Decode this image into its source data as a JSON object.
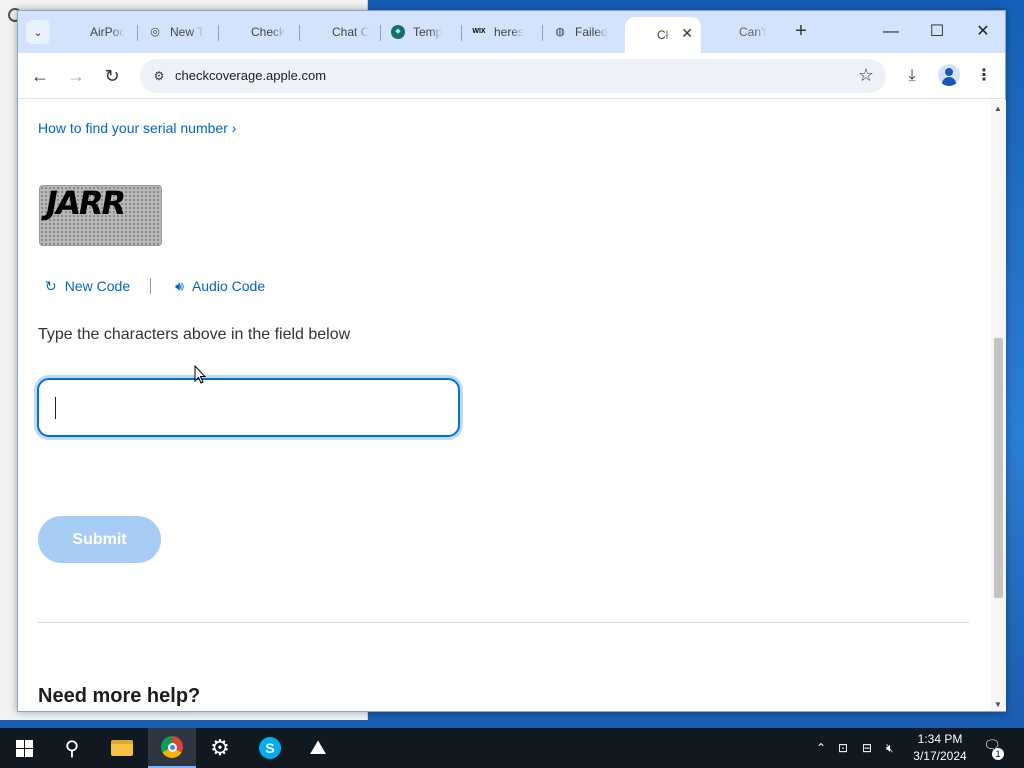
{
  "browser": {
    "tabs": [
      {
        "title": "AirPoc",
        "icon": "apple-icon"
      },
      {
        "title": "New T",
        "icon": "chrome-icon"
      },
      {
        "title": "Check",
        "icon": "apple-icon"
      },
      {
        "title": "Chat C",
        "icon": "apple-icon"
      },
      {
        "title": "Temp",
        "icon": "temp-icon"
      },
      {
        "title": "heres",
        "icon": "wix-icon"
      },
      {
        "title": "Failed",
        "icon": "globe-icon"
      },
      {
        "title": "Cł",
        "icon": "apple-icon",
        "active": true
      },
      {
        "title": "Can't",
        "icon": "apple-icon"
      }
    ],
    "url": "checkcoverage.apple.com",
    "wix_label": "WIX"
  },
  "page": {
    "serial_link": "How to find your serial number ›",
    "captcha_text": "JARR",
    "new_code_label": "New Code",
    "audio_code_label": "Audio Code",
    "instructions": "Type the characters above in the field below",
    "input_value": "",
    "submit_label": "Submit",
    "help_title": "Need more help?"
  },
  "taskbar": {
    "time": "1:34 PM",
    "date": "3/17/2024",
    "notification_count": "1"
  },
  "colors": {
    "link": "#0066cc",
    "focus": "#0071e3",
    "submit_disabled": "#a8cdf5",
    "tabstrip": "#d3e3fd"
  }
}
